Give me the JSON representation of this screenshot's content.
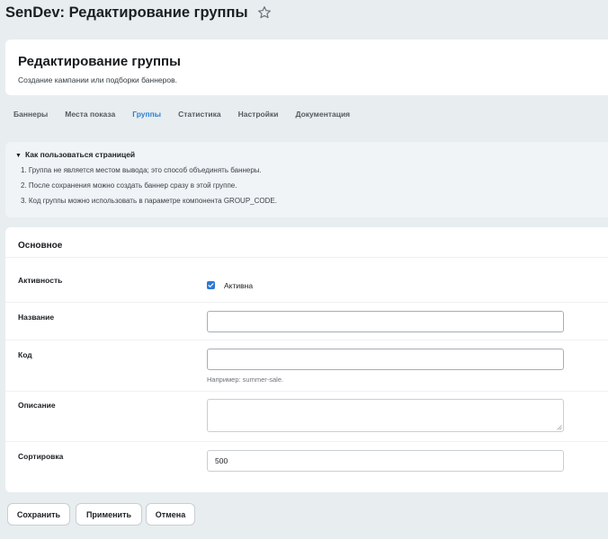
{
  "window": {
    "title": "SenDev: Редактирование группы",
    "favorite_icon": "star-icon"
  },
  "header": {
    "title": "Редактирование группы",
    "subtitle": "Создание кампании или подборки баннеров."
  },
  "tabs": [
    {
      "label": "Баннеры",
      "active": false
    },
    {
      "label": "Места показа",
      "active": false
    },
    {
      "label": "Группы",
      "active": true
    },
    {
      "label": "Статистика",
      "active": false
    },
    {
      "label": "Настройки",
      "active": false
    },
    {
      "label": "Документация",
      "active": false
    }
  ],
  "howto": {
    "summary": "Как пользоваться страницей",
    "toggle_glyph": "▼",
    "items": [
      "1. Группа не является местом вывода; это способ объединять баннеры.",
      "2. После сохранения можно создать баннер сразу в этой группе.",
      "3. Код группы можно использовать в параметре компонента GROUP_CODE."
    ]
  },
  "form": {
    "section_title": "Основное",
    "active": {
      "label": "Активность",
      "checkbox_label": "Активна",
      "checked": true
    },
    "name": {
      "label": "Название",
      "value": ""
    },
    "code": {
      "label": "Код",
      "value": "",
      "hint": "Например: summer-sale."
    },
    "description": {
      "label": "Описание",
      "value": ""
    },
    "sort": {
      "label": "Сортировка",
      "value": "500"
    }
  },
  "buttons": {
    "save": "Сохранить",
    "apply": "Применить",
    "cancel": "Отмена"
  },
  "colors": {
    "accent": "#2c78d4",
    "active_tab": "#2d7fd3",
    "page_bg": "#e8edef",
    "howto_bg": "#f0f4f7"
  }
}
